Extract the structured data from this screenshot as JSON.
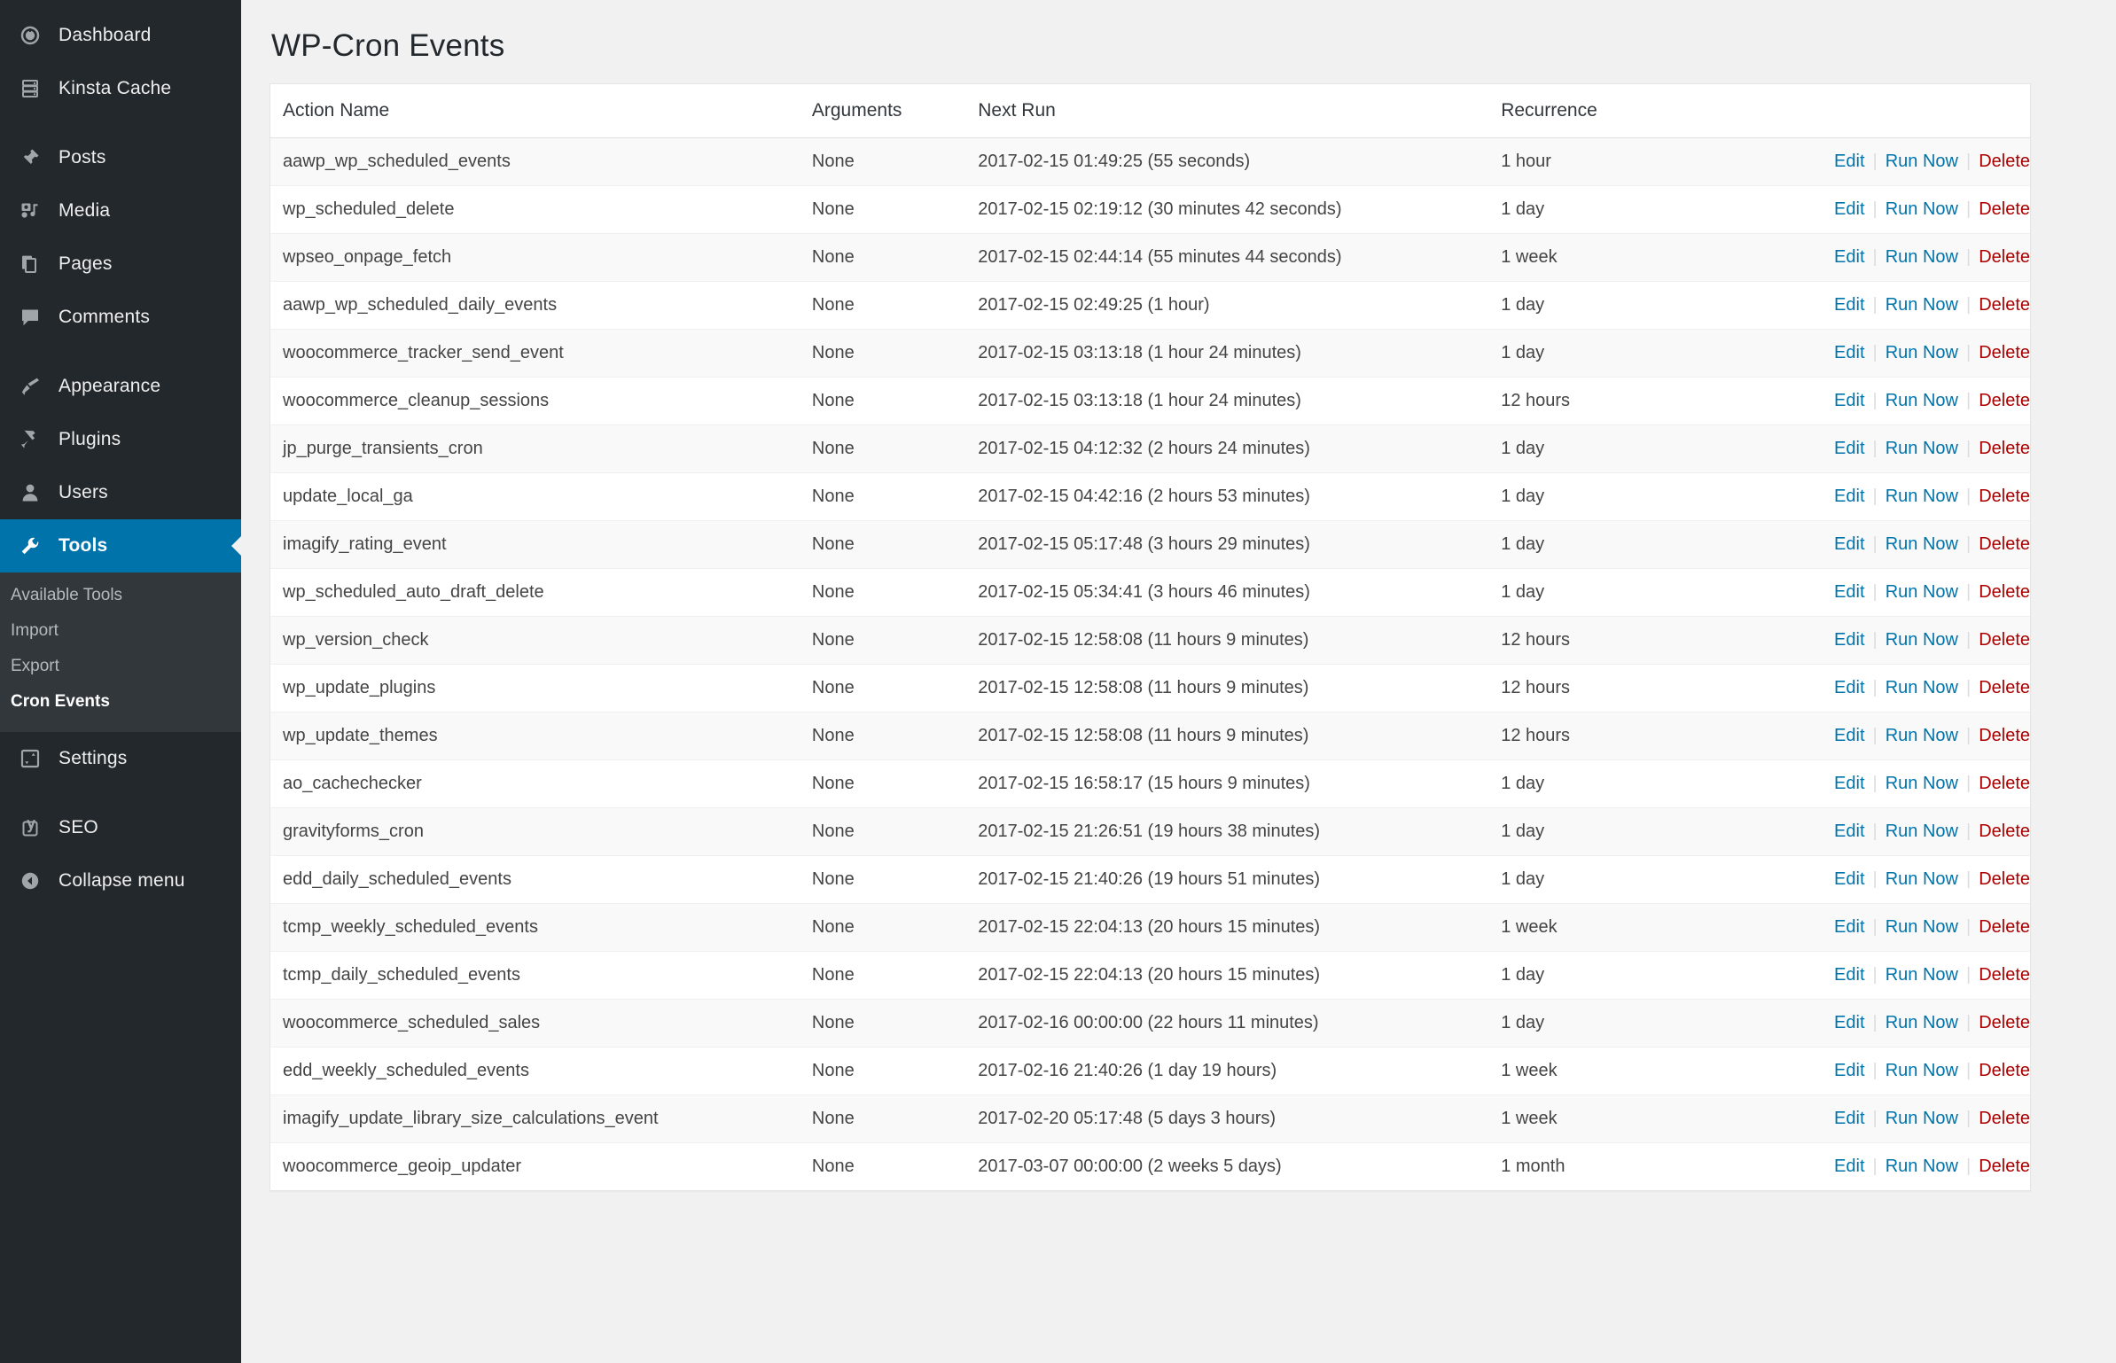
{
  "sidebar": {
    "items": [
      {
        "label": "Dashboard",
        "icon": "dashboard-icon",
        "active": false
      },
      {
        "label": "Kinsta Cache",
        "icon": "server-icon",
        "active": false
      },
      {
        "label": "Posts",
        "icon": "pin-icon",
        "active": false
      },
      {
        "label": "Media",
        "icon": "media-icon",
        "active": false
      },
      {
        "label": "Pages",
        "icon": "pages-icon",
        "active": false
      },
      {
        "label": "Comments",
        "icon": "comment-icon",
        "active": false
      },
      {
        "label": "Appearance",
        "icon": "brush-icon",
        "active": false
      },
      {
        "label": "Plugins",
        "icon": "plug-icon",
        "active": false
      },
      {
        "label": "Users",
        "icon": "user-icon",
        "active": false
      },
      {
        "label": "Tools",
        "icon": "wrench-icon",
        "active": true
      },
      {
        "label": "Settings",
        "icon": "settings-icon",
        "active": false
      },
      {
        "label": "SEO",
        "icon": "yoast-icon",
        "active": false
      },
      {
        "label": "Collapse menu",
        "icon": "collapse-icon",
        "active": false
      }
    ],
    "submenu": [
      {
        "label": "Available Tools",
        "current": false
      },
      {
        "label": "Import",
        "current": false
      },
      {
        "label": "Export",
        "current": false
      },
      {
        "label": "Cron Events",
        "current": true
      }
    ],
    "accent_color": "#0073aa",
    "background_color": "#23282d",
    "submenu_background_color": "#32373c"
  },
  "page": {
    "title": "WP-Cron Events"
  },
  "table": {
    "headers": {
      "action": "Action Name",
      "arguments": "Arguments",
      "next_run": "Next Run",
      "recurrence": "Recurrence"
    },
    "row_actions": {
      "edit": "Edit",
      "run_now": "Run Now",
      "delete": "Delete"
    },
    "link_color": "#0073aa",
    "delete_color": "#a00",
    "rows": [
      {
        "action": "aawp_wp_scheduled_events",
        "arguments": "None",
        "next_run": "2017-02-15 01:49:25 (55 seconds)",
        "recurrence": "1 hour"
      },
      {
        "action": "wp_scheduled_delete",
        "arguments": "None",
        "next_run": "2017-02-15 02:19:12 (30 minutes 42 seconds)",
        "recurrence": "1 day"
      },
      {
        "action": "wpseo_onpage_fetch",
        "arguments": "None",
        "next_run": "2017-02-15 02:44:14 (55 minutes 44 seconds)",
        "recurrence": "1 week"
      },
      {
        "action": "aawp_wp_scheduled_daily_events",
        "arguments": "None",
        "next_run": "2017-02-15 02:49:25 (1 hour)",
        "recurrence": "1 day"
      },
      {
        "action": "woocommerce_tracker_send_event",
        "arguments": "None",
        "next_run": "2017-02-15 03:13:18 (1 hour 24 minutes)",
        "recurrence": "1 day"
      },
      {
        "action": "woocommerce_cleanup_sessions",
        "arguments": "None",
        "next_run": "2017-02-15 03:13:18 (1 hour 24 minutes)",
        "recurrence": "12 hours"
      },
      {
        "action": "jp_purge_transients_cron",
        "arguments": "None",
        "next_run": "2017-02-15 04:12:32 (2 hours 24 minutes)",
        "recurrence": "1 day"
      },
      {
        "action": "update_local_ga",
        "arguments": "None",
        "next_run": "2017-02-15 04:42:16 (2 hours 53 minutes)",
        "recurrence": "1 day"
      },
      {
        "action": "imagify_rating_event",
        "arguments": "None",
        "next_run": "2017-02-15 05:17:48 (3 hours 29 minutes)",
        "recurrence": "1 day"
      },
      {
        "action": "wp_scheduled_auto_draft_delete",
        "arguments": "None",
        "next_run": "2017-02-15 05:34:41 (3 hours 46 minutes)",
        "recurrence": "1 day"
      },
      {
        "action": "wp_version_check",
        "arguments": "None",
        "next_run": "2017-02-15 12:58:08 (11 hours 9 minutes)",
        "recurrence": "12 hours"
      },
      {
        "action": "wp_update_plugins",
        "arguments": "None",
        "next_run": "2017-02-15 12:58:08 (11 hours 9 minutes)",
        "recurrence": "12 hours"
      },
      {
        "action": "wp_update_themes",
        "arguments": "None",
        "next_run": "2017-02-15 12:58:08 (11 hours 9 minutes)",
        "recurrence": "12 hours"
      },
      {
        "action": "ao_cachechecker",
        "arguments": "None",
        "next_run": "2017-02-15 16:58:17 (15 hours 9 minutes)",
        "recurrence": "1 day"
      },
      {
        "action": "gravityforms_cron",
        "arguments": "None",
        "next_run": "2017-02-15 21:26:51 (19 hours 38 minutes)",
        "recurrence": "1 day"
      },
      {
        "action": "edd_daily_scheduled_events",
        "arguments": "None",
        "next_run": "2017-02-15 21:40:26 (19 hours 51 minutes)",
        "recurrence": "1 day"
      },
      {
        "action": "tcmp_weekly_scheduled_events",
        "arguments": "None",
        "next_run": "2017-02-15 22:04:13 (20 hours 15 minutes)",
        "recurrence": "1 week"
      },
      {
        "action": "tcmp_daily_scheduled_events",
        "arguments": "None",
        "next_run": "2017-02-15 22:04:13 (20 hours 15 minutes)",
        "recurrence": "1 day"
      },
      {
        "action": "woocommerce_scheduled_sales",
        "arguments": "None",
        "next_run": "2017-02-16 00:00:00 (22 hours 11 minutes)",
        "recurrence": "1 day"
      },
      {
        "action": "edd_weekly_scheduled_events",
        "arguments": "None",
        "next_run": "2017-02-16 21:40:26 (1 day 19 hours)",
        "recurrence": "1 week"
      },
      {
        "action": "imagify_update_library_size_calculations_event",
        "arguments": "None",
        "next_run": "2017-02-20 05:17:48 (5 days 3 hours)",
        "recurrence": "1 week"
      },
      {
        "action": "woocommerce_geoip_updater",
        "arguments": "None",
        "next_run": "2017-03-07 00:00:00 (2 weeks 5 days)",
        "recurrence": "1 month"
      }
    ]
  }
}
